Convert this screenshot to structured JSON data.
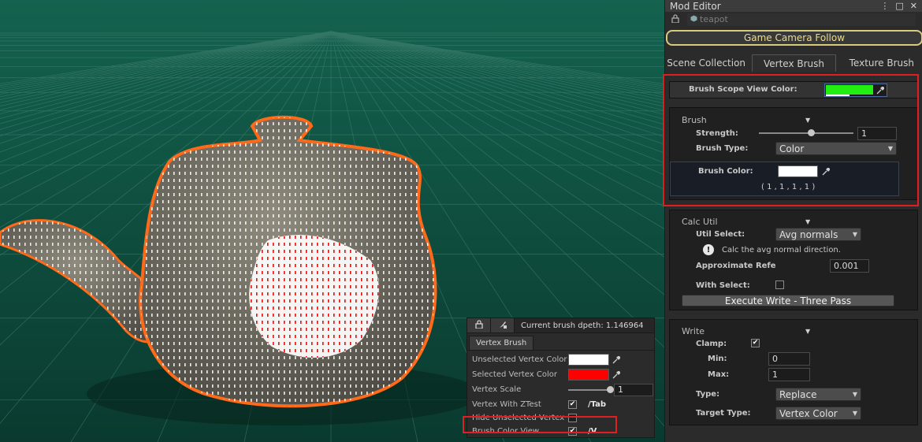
{
  "panel": {
    "title": "Mod Editor",
    "title_icons": [
      "more-vert-icon",
      "maximize-icon",
      "close-icon"
    ],
    "object_name": "teapot",
    "camera_button": "Game Camera Follow",
    "tabs": [
      {
        "label": "Scene Collection",
        "active": false
      },
      {
        "label": "Vertex Brush",
        "active": true
      },
      {
        "label": "Texture Brush",
        "active": false
      }
    ],
    "scope": {
      "label": "Brush Scope View Color:",
      "color": "#22ee11"
    },
    "brush": {
      "header": "Brush",
      "strength_label": "Strength:",
      "strength_value": "1",
      "strength_level": 0.55,
      "type_label": "Brush Type:",
      "type_value": "Color",
      "color_label": "Brush Color:",
      "color_swatch": "#ffffff",
      "color_value": "( 1 , 1 , 1 , 1 )"
    },
    "calc": {
      "header": "Calc Util",
      "util_label": "Util Select:",
      "util_value": "Avg normals",
      "info_text": "Calc the avg normal direction.",
      "approx_label": "Approximate Refe",
      "approx_value": "0.001",
      "with_select_label": "With Select:",
      "with_select_checked": false,
      "execute_button": "Execute Write - Three Pass"
    },
    "write": {
      "header": "Write",
      "clamp_label": "Clamp:",
      "clamp_checked": true,
      "min_label": "Min:",
      "min_value": "0",
      "max_label": "Max:",
      "max_value": "1",
      "type_label": "Type:",
      "type_value": "Replace",
      "target_label": "Target Type:",
      "target_value": "Vertex Color"
    }
  },
  "overlay": {
    "depth_text": "Current brush dpeth: 1.146964",
    "tab": "Vertex Brush",
    "unselected_label": "Unselected Vertex Color",
    "unselected_color": "#ffffff",
    "selected_label": "Selected Vertex Color",
    "selected_color": "#ff0000",
    "scale_label": "Vertex Scale",
    "scale_value": "1",
    "scale_level": 1.0,
    "ztest_label": "Vertex With ZTest",
    "ztest_checked": true,
    "ztest_hotkey": "/Tab",
    "hide_label": "Hide Unselected Vertex",
    "hide_checked": false,
    "view_label": "Brush Color View",
    "view_checked": true,
    "view_hotkey": "/V"
  },
  "colors": {
    "highlight": "#e02020",
    "selection_outline": "#ff6a1a",
    "viewport_bg": "#0f5a48"
  }
}
